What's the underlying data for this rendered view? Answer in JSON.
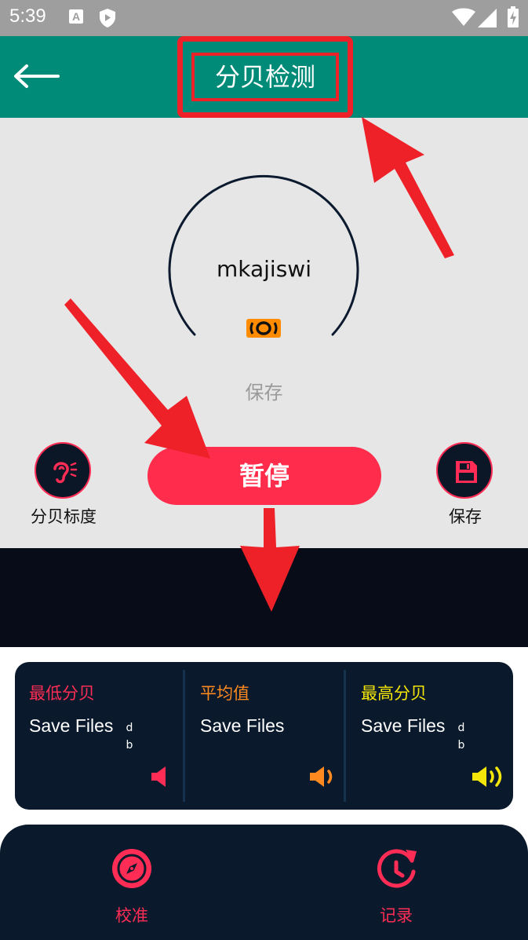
{
  "status_bar": {
    "time": "5:39",
    "a_badge": "A"
  },
  "app_bar": {
    "title": "分贝检测"
  },
  "meter": {
    "value": "mkajiswi",
    "hint": "保存"
  },
  "actions": {
    "left_label": "分贝标度",
    "pause_label": "暂停",
    "right_label": "保存"
  },
  "stats": [
    {
      "label": "最低分贝",
      "value": "Save Files",
      "unit_top": "d",
      "unit_bottom": "b",
      "color": "#ff2d55",
      "icon": "volume-mute-icon"
    },
    {
      "label": "平均值",
      "value": "Save Files",
      "unit_top": "",
      "unit_bottom": "",
      "color": "#ff8a1f",
      "icon": "volume-low-icon"
    },
    {
      "label": "最高分贝",
      "value": "Save Files",
      "unit_top": "d",
      "unit_bottom": "b",
      "color": "#f5e60a",
      "icon": "volume-high-icon"
    }
  ],
  "nav": [
    {
      "label": "校准",
      "icon": "compass-icon"
    },
    {
      "label": "记录",
      "icon": "history-icon"
    }
  ],
  "colors": {
    "accent": "#ff2d55",
    "app_bar": "#008a78",
    "dark": "#0a1a2c",
    "annotation": "#ee2028"
  }
}
